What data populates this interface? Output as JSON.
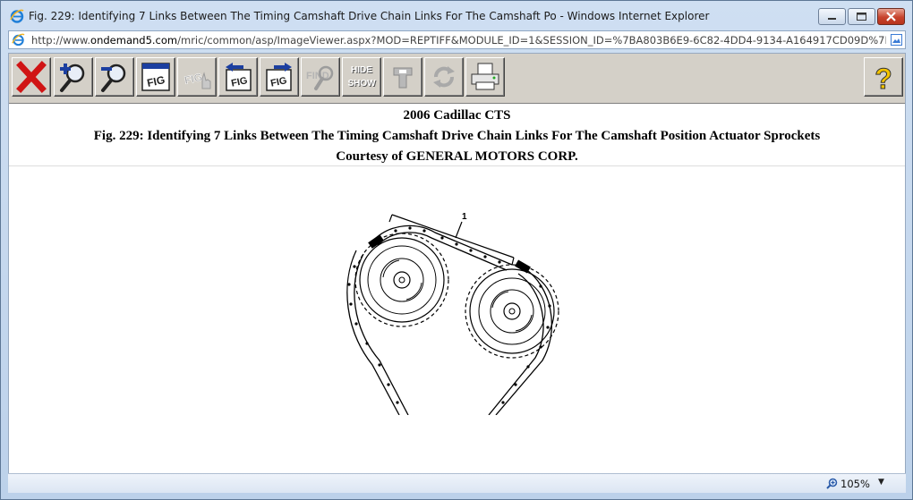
{
  "window": {
    "title": "Fig. 229: Identifying 7 Links Between The Timing Camshaft Drive Chain Links For The Camshaft Po - Windows Internet Explorer"
  },
  "address": {
    "prefix": "http://www.",
    "domain": "ondemand5.com",
    "path": "/mric/common/asp/ImageViewer.aspx?MOD=REPTIFF&MODULE_ID=1&SESSION_ID=%7BA803B6E9-6C82-4DD4-9134-A164917CD09D%7D&IMAGE_GUI"
  },
  "toolbar": {
    "items": [
      {
        "name": "close-button",
        "icon": "red-x-icon"
      },
      {
        "name": "zoom-in-button",
        "icon": "magnifier-plus-icon"
      },
      {
        "name": "zoom-out-button",
        "icon": "magnifier-minus-icon"
      },
      {
        "name": "fig-button",
        "icon": "fig-icon",
        "label": "FIG"
      },
      {
        "name": "fig-hand-button",
        "icon": "fig-hand-icon",
        "label": "FIG"
      },
      {
        "name": "previous-fig-button",
        "icon": "fig-prev-icon",
        "label": "FIG"
      },
      {
        "name": "next-fig-button",
        "icon": "fig-next-icon",
        "label": "FIG"
      },
      {
        "name": "find-button",
        "icon": "find-icon",
        "label": "FIND"
      },
      {
        "name": "hide-show-button",
        "icon": "hide-show-icon",
        "label_top": "HIDE",
        "label_bottom": "SHOW"
      },
      {
        "name": "tools-button",
        "icon": "tool-icon"
      },
      {
        "name": "rotate-button",
        "icon": "rotate-icon"
      },
      {
        "name": "print-button",
        "icon": "printer-icon"
      },
      {
        "name": "help-button",
        "icon": "help-icon",
        "label": "?"
      }
    ]
  },
  "heading": {
    "line1": "2006 Cadillac CTS",
    "line2": "Fig. 229: Identifying 7 Links Between The Timing Camshaft Drive Chain Links For The Camshaft Position Actuator Sprockets",
    "line3": "Courtesy of GENERAL MOTORS CORP."
  },
  "figure": {
    "callout": "1"
  },
  "status": {
    "zoom": "105%"
  },
  "colors": {
    "close_red": "#d01414",
    "toolbar_gray": "#d4d0c8"
  }
}
